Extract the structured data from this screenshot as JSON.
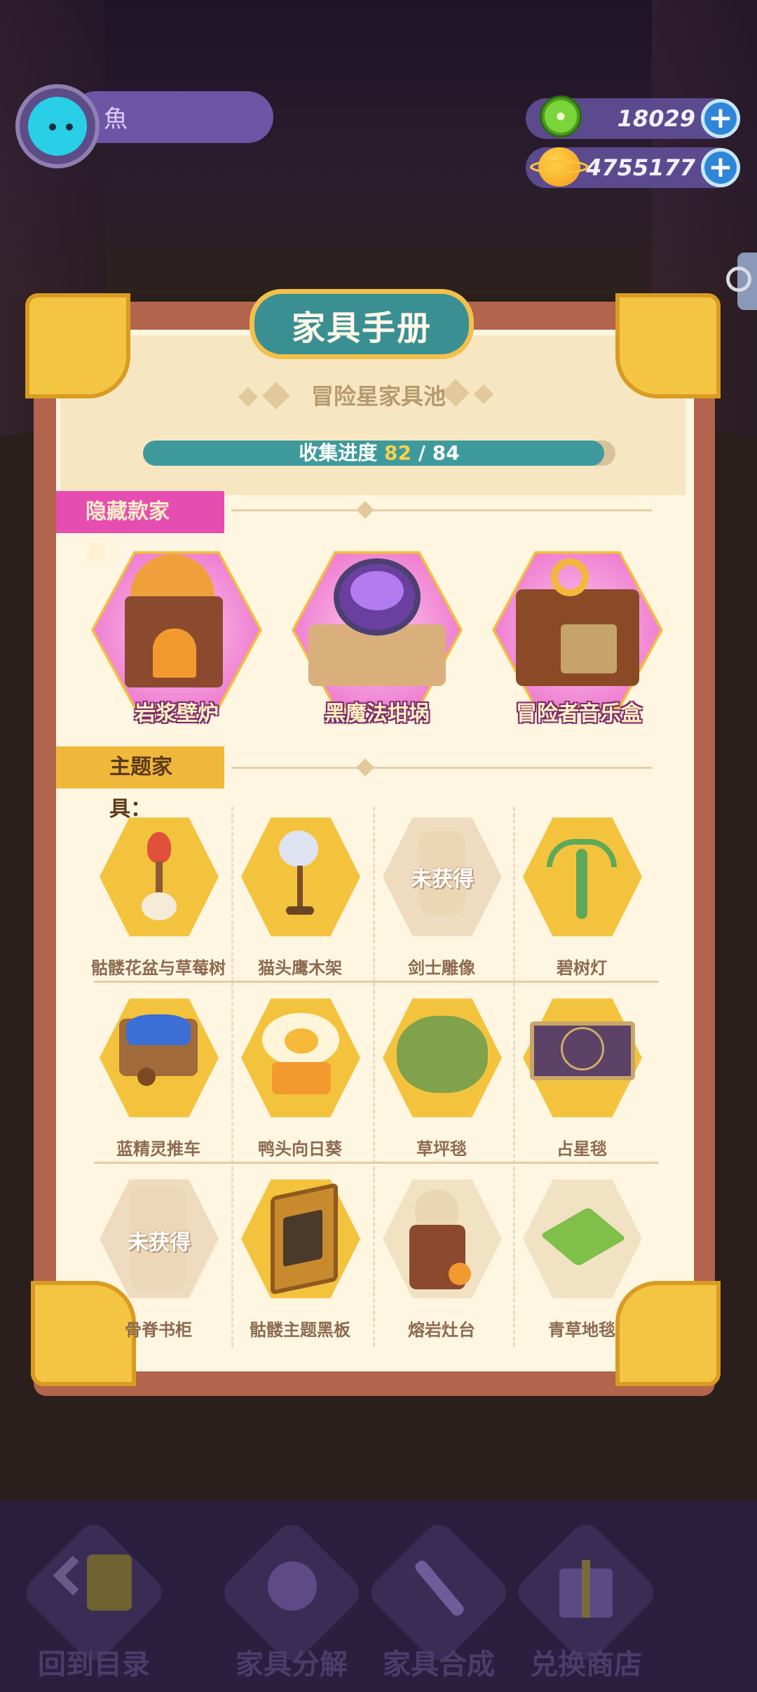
{
  "player": {
    "name": "魚"
  },
  "currencies": [
    {
      "name": "green-coin",
      "value": "18029"
    },
    {
      "name": "planet-coin",
      "value": "4755177"
    }
  ],
  "book": {
    "title": "家具手册",
    "pool_title": "冒险星家具池",
    "progress": {
      "label": "收集进度",
      "current": "82",
      "separator": "/",
      "total": "84",
      "fraction": 0.976
    },
    "hidden_section": {
      "title": "隐藏款家具：",
      "items": [
        {
          "name": "岩浆壁炉"
        },
        {
          "name": "黑魔法坩埚"
        },
        {
          "name": "冒险者音乐盒"
        }
      ]
    },
    "theme_section": {
      "title": "主题家具：",
      "locked_text": "未获得",
      "items": [
        {
          "name": "骷髅花盆与草莓树",
          "locked": false,
          "icon": "strawberry-tree-icon"
        },
        {
          "name": "猫头鹰木架",
          "locked": false,
          "icon": "owl-perch-icon"
        },
        {
          "name": "剑士雕像",
          "locked": true,
          "icon": "swordsman-statue-icon"
        },
        {
          "name": "碧树灯",
          "locked": false,
          "icon": "jade-tree-lamp-icon"
        },
        {
          "name": "蓝精灵推车",
          "locked": false,
          "icon": "blue-cart-icon"
        },
        {
          "name": "鸭头向日葵",
          "locked": false,
          "icon": "duck-sunflower-icon"
        },
        {
          "name": "草坪毯",
          "locked": false,
          "icon": "lawn-rug-icon"
        },
        {
          "name": "占星毯",
          "locked": false,
          "icon": "astrology-rug-icon"
        },
        {
          "name": "骨脊书柜",
          "locked": true,
          "icon": "bone-bookshelf-icon"
        },
        {
          "name": "骷髅主题黑板",
          "locked": false,
          "icon": "skull-blackboard-icon"
        },
        {
          "name": "熔岩灶台",
          "locked": false,
          "icon": "lava-stove-icon"
        },
        {
          "name": "青草地毯",
          "locked": false,
          "icon": "grass-carpet-icon"
        }
      ]
    }
  },
  "nav": {
    "back": "回到目录",
    "decompose": "家具分解",
    "craft": "家具合成",
    "shop": "兑换商店"
  },
  "colors": {
    "frame": "#b2644c",
    "gold": "#f4c542",
    "teal": "#3e9a9c",
    "hidden_tag": "#e54db0",
    "hidden_hex": "#e86bc8"
  }
}
